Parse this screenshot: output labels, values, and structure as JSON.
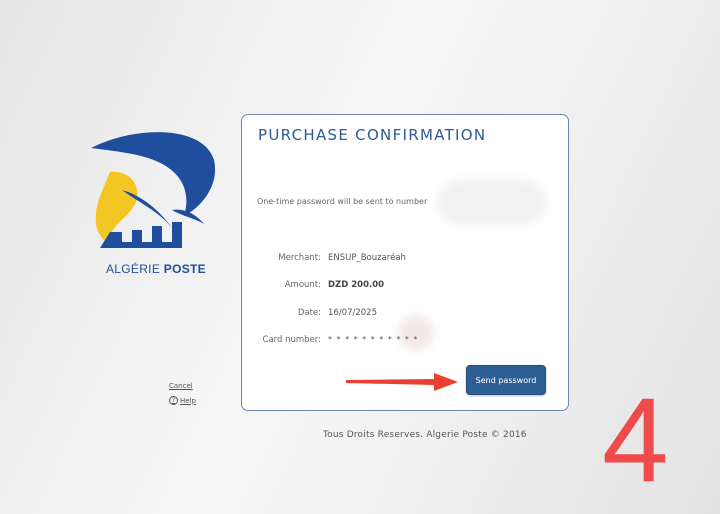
{
  "brand": {
    "prefix": "ALGÉRIE ",
    "suffix": "POSTE"
  },
  "side_links": {
    "cancel": "Cancel",
    "help": "Help"
  },
  "card": {
    "title": "PURCHASE CONFIRMATION",
    "otp_notice": "One-time password will be sent to number",
    "fields": {
      "merchant_label": "Merchant:",
      "merchant_value": "ENSUP_Bouzaréah",
      "amount_label": "Amount:",
      "amount_value": "DZD 200.00",
      "date_label": "Date:",
      "date_value": "16/07/2025",
      "card_label": "Card number:",
      "card_value": "* * * * * * * * * * *"
    },
    "send_button": "Send password"
  },
  "footer": "Tous Droits Reserves. Algerie Poste © 2016",
  "step_number": "4",
  "colors": {
    "brand_blue": "#2d5b94",
    "button": "#2e5f94",
    "arrow": "#e8412f",
    "logo_yellow": "#f3c623"
  },
  "icons": [
    "algerie-poste-logo",
    "help-icon",
    "red-arrow"
  ]
}
